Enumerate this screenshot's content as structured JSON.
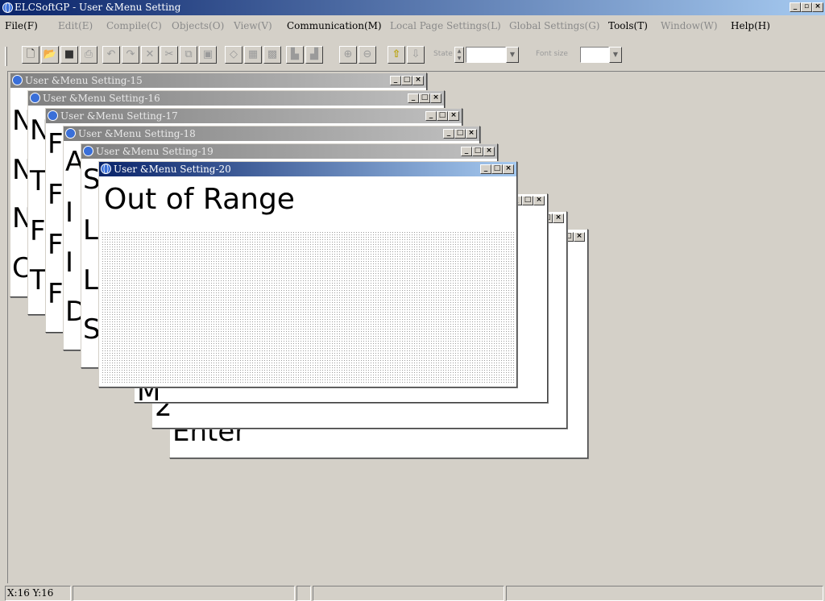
{
  "app": {
    "title": "ELCSoftGP - User &Menu Setting"
  },
  "menu": [
    {
      "label": "File(F)",
      "enabled": true
    },
    {
      "label": "Edit(E)",
      "enabled": false
    },
    {
      "label": "Compile(C)",
      "enabled": false
    },
    {
      "label": "Objects(O)",
      "enabled": false
    },
    {
      "label": "View(V)",
      "enabled": false
    },
    {
      "label": "Communication(M)",
      "enabled": true
    },
    {
      "label": "Local Page Settings(L)",
      "enabled": false
    },
    {
      "label": "Global Settings(G)",
      "enabled": false
    },
    {
      "label": "Tools(T)",
      "enabled": true
    },
    {
      "label": "Window(W)",
      "enabled": false
    },
    {
      "label": "Help(H)",
      "enabled": true
    }
  ],
  "toolbar": {
    "state_label": "State",
    "fontsize_label": "Font size",
    "icons": [
      "new-icon",
      "open-icon",
      "save-icon",
      "print-icon",
      "undo-icon",
      "redo-icon",
      "delete-icon",
      "cut-icon",
      "copy-icon",
      "paste-icon",
      "eraser-icon",
      "download-icon",
      "upload-icon",
      "import-icon",
      "export-icon",
      "zoom-in-icon",
      "zoom-out-icon",
      "arrow-up-icon",
      "arrow-down-icon"
    ]
  },
  "windows": [
    {
      "title": "User &Menu Setting-15",
      "lines": [
        "N",
        "N",
        "N",
        "C"
      ]
    },
    {
      "title": "User &Menu Setting-16",
      "lines": [
        "N",
        "T",
        "F",
        "T"
      ]
    },
    {
      "title": "User &Menu Setting-17",
      "lines": [
        "F",
        "F",
        "F",
        "F"
      ]
    },
    {
      "title": "User &Menu Setting-18",
      "lines": [
        "A",
        "I",
        "I",
        "D"
      ]
    },
    {
      "title": "User &Menu Setting-19",
      "lines": [
        "S",
        "L",
        "L",
        "S"
      ]
    },
    {
      "title": "User &Menu Setting-20",
      "lines": [
        "Out of Range"
      ]
    }
  ],
  "back_windows": {
    "a_lines": [
      "M"
    ],
    "b_lines": [
      "2"
    ],
    "c_lines": [
      "Enter"
    ]
  },
  "status": {
    "coords": "X:16 Y:16"
  },
  "colors": {
    "title_active": "#0a246a",
    "title_inactive": "#808080",
    "face": "#d4d0c8"
  }
}
